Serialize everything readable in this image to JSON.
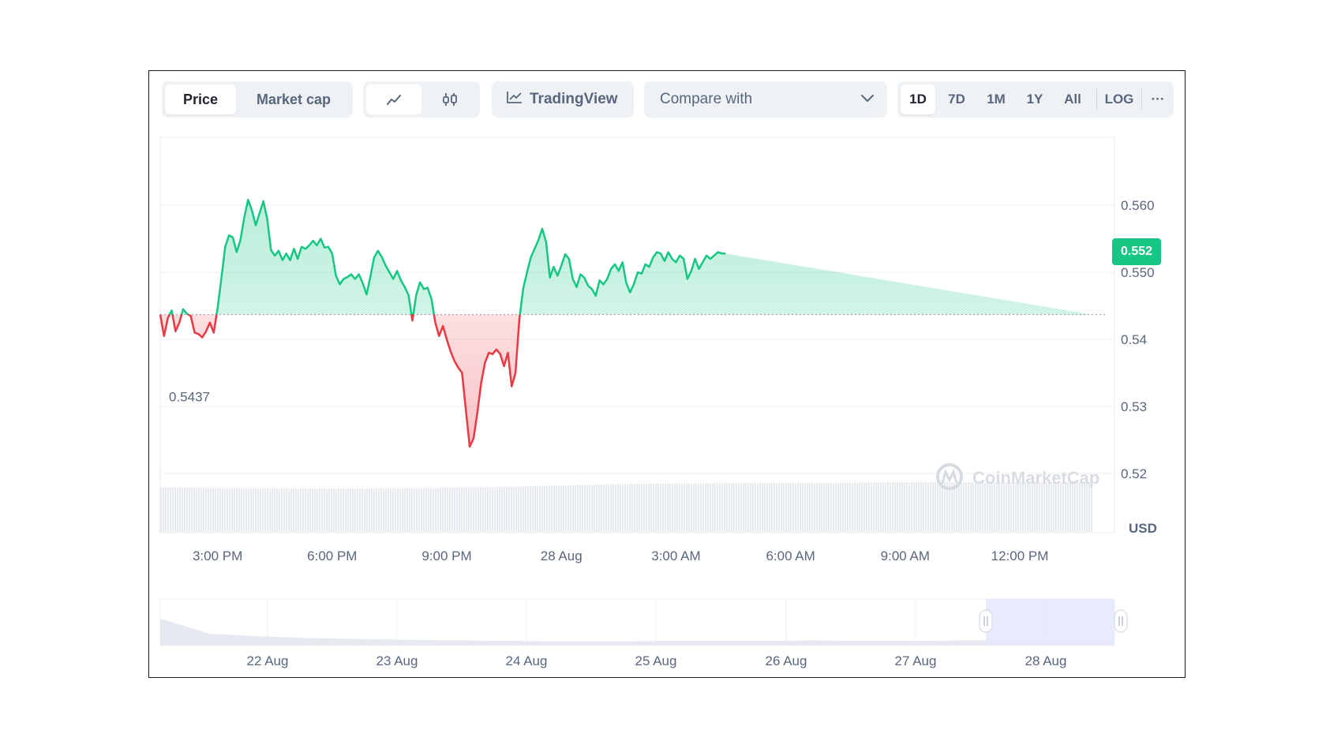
{
  "toolbar": {
    "metric_tabs": [
      {
        "label": "Price",
        "active": true
      },
      {
        "label": "Market cap",
        "active": false
      }
    ],
    "chart_type_icons": [
      {
        "name": "line-chart-icon",
        "active": true
      },
      {
        "name": "candlestick-icon",
        "active": false
      }
    ],
    "tradingview_label": "TradingView",
    "compare_label": "Compare with",
    "ranges": [
      "1D",
      "7D",
      "1M",
      "1Y",
      "All"
    ],
    "active_range": "1D",
    "log_label": "LOG",
    "more_label": "···"
  },
  "watermark": "CoinMarketCap",
  "currency_label": "USD",
  "current_price_label": "0.552",
  "baseline_label": "0.5437",
  "colors": {
    "up": "#16c784",
    "down": "#ea3943",
    "up_fill": "#d5f5e7",
    "down_fill": "#fcd6d9",
    "axis_text": "#58667e",
    "grid": "#eff2f5"
  },
  "chart_data": {
    "type": "area",
    "baseline": 0.5437,
    "current_price": 0.552,
    "y_ticks": [
      "0.560",
      "0.550",
      "0.54",
      "0.53",
      "0.52"
    ],
    "ylim": [
      0.52,
      0.56
    ],
    "x_tick_labels": [
      "3:00 PM",
      "6:00 PM",
      "9:00 PM",
      "28 Aug",
      "3:00 AM",
      "6:00 AM",
      "9:00 AM",
      "12:00 PM"
    ],
    "navigator_labels": [
      "22 Aug",
      "23 Aug",
      "24 Aug",
      "25 Aug",
      "26 Aug",
      "27 Aug",
      "28 Aug"
    ],
    "x_hours": [
      0,
      0.1,
      0.2,
      0.3,
      0.4,
      0.5,
      0.6,
      0.7,
      0.8,
      0.9,
      1.0,
      1.1,
      1.2,
      1.3,
      1.4,
      1.5,
      1.6,
      1.7,
      1.8,
      1.9,
      2.0,
      2.1,
      2.2,
      2.3,
      2.4,
      2.5,
      2.6,
      2.7,
      2.8,
      2.9,
      3.0,
      3.1,
      3.2,
      3.3,
      3.4,
      3.5,
      3.6,
      3.7,
      3.8,
      3.9,
      4.0,
      4.1,
      4.2,
      4.3,
      4.4,
      4.5,
      4.6,
      4.7,
      4.8,
      4.9,
      5.0,
      5.1,
      5.2,
      5.3,
      5.4,
      5.5,
      5.6,
      5.7,
      5.8,
      5.9,
      6.0,
      6.1,
      6.2,
      6.3,
      6.4,
      6.5,
      6.6,
      6.7,
      6.8,
      6.9,
      7.0,
      7.1,
      7.2,
      7.3,
      7.4,
      7.5,
      7.6,
      7.7,
      7.8,
      7.9,
      8.0,
      8.1,
      8.2,
      8.3,
      8.4,
      8.5,
      8.6,
      8.7,
      8.8,
      8.9,
      9.0,
      9.1,
      9.2,
      9.3,
      9.4,
      9.5,
      9.6,
      9.7,
      9.8,
      9.9,
      10.0,
      10.1,
      10.2,
      10.3,
      10.4,
      10.5,
      10.6,
      10.7,
      10.8,
      10.9,
      11.0,
      11.1,
      11.2,
      11.3,
      11.4,
      11.5,
      11.6,
      11.7,
      11.8,
      11.9,
      12.0,
      12.1,
      12.2,
      12.3,
      12.4,
      12.5,
      12.6,
      12.7,
      12.8,
      12.9,
      13.0,
      13.1,
      13.2,
      13.3,
      13.4,
      13.5,
      13.6,
      13.7,
      13.8,
      13.9,
      14.0,
      14.1,
      14.2,
      14.3,
      14.4,
      14.5,
      14.6,
      14.7,
      14.8,
      14.9,
      15.0,
      15.1,
      15.2,
      15.3,
      15.4,
      15.5,
      15.6,
      15.7,
      15.8,
      15.9,
      16.0,
      16.1,
      16.2,
      16.3,
      16.4,
      16.5,
      16.6,
      16.7,
      16.8,
      16.9,
      17.0,
      17.1,
      17.2,
      17.3,
      17.4,
      17.5,
      17.6,
      17.7,
      17.8,
      17.9,
      18.0,
      18.1,
      18.2,
      18.3,
      18.4,
      18.5,
      18.6,
      18.7,
      18.8,
      18.9,
      19.0,
      19.1,
      19.2,
      19.3,
      19.4,
      19.5,
      19.6,
      19.7,
      19.8,
      19.9,
      20.0,
      20.1,
      20.2,
      20.3,
      20.4,
      20.5,
      20.6,
      20.7,
      20.8,
      20.9,
      21.0,
      21.1,
      21.2,
      21.3,
      21.4,
      21.5,
      21.6,
      21.7,
      21.8,
      21.9,
      22.0,
      22.1,
      22.2,
      22.3,
      22.4,
      22.5,
      22.6,
      22.7,
      22.8,
      22.9,
      23.0,
      23.1,
      23.2,
      23.3,
      23.4,
      23.5,
      23.6,
      23.7,
      23.8,
      23.9,
      24.0,
      24.1,
      24.2,
      24.3,
      24.4
    ],
    "prices": [
      0.5437,
      0.5405,
      0.5432,
      0.5443,
      0.5412,
      0.5425,
      0.5445,
      0.5438,
      0.5435,
      0.541,
      0.5408,
      0.5403,
      0.5412,
      0.5425,
      0.541,
      0.5446,
      0.549,
      0.5538,
      0.5555,
      0.5552,
      0.553,
      0.5548,
      0.5582,
      0.5608,
      0.5592,
      0.557,
      0.5588,
      0.5606,
      0.558,
      0.5533,
      0.5525,
      0.5532,
      0.5518,
      0.5528,
      0.5518,
      0.5535,
      0.552,
      0.5538,
      0.5535,
      0.554,
      0.5547,
      0.554,
      0.555,
      0.5537,
      0.5538,
      0.5528,
      0.5495,
      0.5482,
      0.549,
      0.5493,
      0.5497,
      0.549,
      0.5497,
      0.5484,
      0.5467,
      0.5493,
      0.5522,
      0.5532,
      0.5523,
      0.551,
      0.55,
      0.549,
      0.5502,
      0.5488,
      0.5478,
      0.5466,
      0.5428,
      0.5466,
      0.5485,
      0.5475,
      0.5477,
      0.546,
      0.5425,
      0.5405,
      0.542,
      0.54,
      0.5382,
      0.5368,
      0.5358,
      0.535,
      0.5295,
      0.524,
      0.5252,
      0.529,
      0.5335,
      0.5365,
      0.538,
      0.5378,
      0.5385,
      0.5378,
      0.536,
      0.538,
      0.533,
      0.535,
      0.543,
      0.5475,
      0.55,
      0.5522,
      0.5535,
      0.5548,
      0.5565,
      0.5545,
      0.5492,
      0.5508,
      0.5495,
      0.551,
      0.5527,
      0.552,
      0.549,
      0.5478,
      0.5497,
      0.5492,
      0.548,
      0.5475,
      0.5465,
      0.5488,
      0.5482,
      0.549,
      0.5505,
      0.5512,
      0.5502,
      0.5515,
      0.5484,
      0.547,
      0.5483,
      0.55,
      0.5498,
      0.5512,
      0.5508,
      0.5522,
      0.553,
      0.5528,
      0.5517,
      0.553,
      0.552,
      0.5515,
      0.5525,
      0.552,
      0.549,
      0.5502,
      0.552,
      0.5505,
      0.5515,
      0.5525,
      0.552,
      0.5525,
      0.553,
      0.5528,
      0.5528
    ],
    "volume_trend": [
      0.76,
      0.75,
      0.74,
      0.74,
      0.75,
      0.77,
      0.8,
      0.83,
      0.84,
      0.85,
      0.85,
      0.86,
      0.86,
      0.86,
      0.86
    ],
    "navigator_trend": [
      0.58,
      0.25,
      0.2,
      0.16,
      0.14,
      0.12,
      0.11,
      0.1,
      0.09,
      0.09,
      0.1,
      0.1,
      0.1,
      0.11,
      0.1,
      0.1,
      0.11,
      0.11,
      0.12,
      0.12
    ]
  }
}
